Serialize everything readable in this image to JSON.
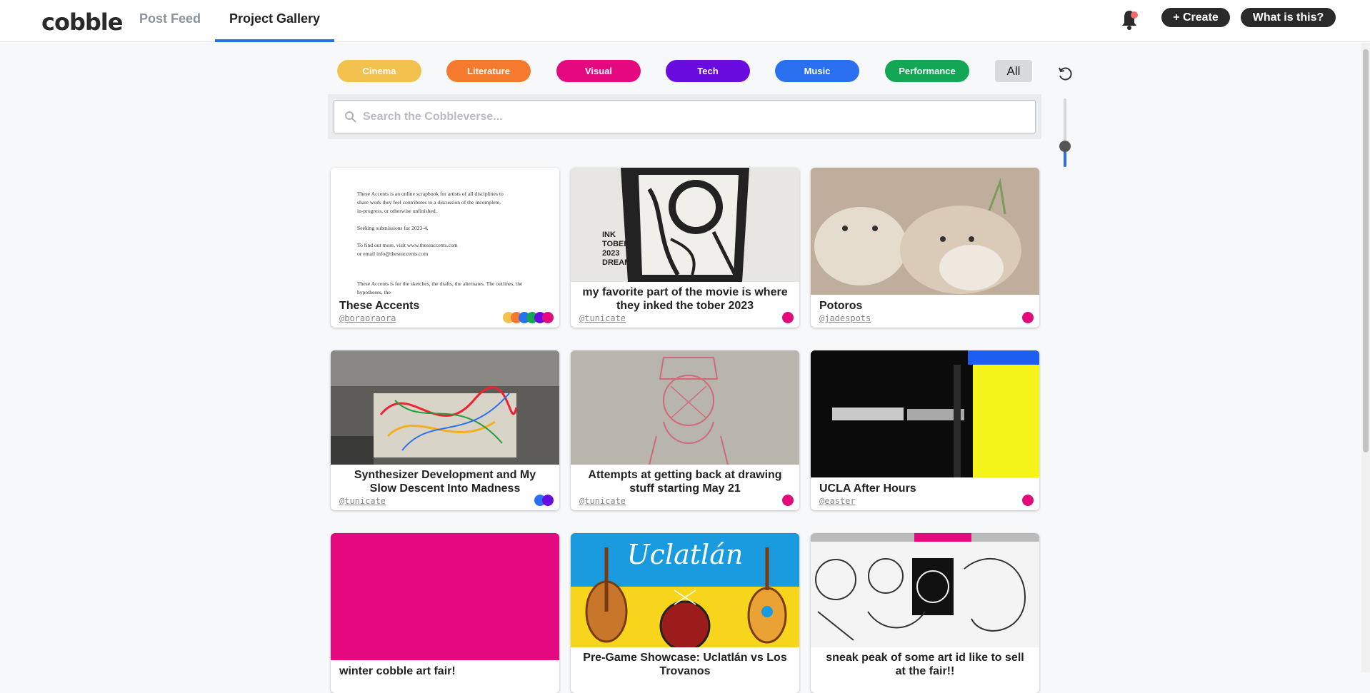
{
  "header": {
    "logo": "cobble",
    "tabs": [
      {
        "label": "Post Feed"
      },
      {
        "label": "Project Gallery"
      }
    ],
    "create_label": "+ Create",
    "about_label": "What is this?"
  },
  "categories": [
    {
      "label": "Cinema",
      "color": "#f2c14e"
    },
    {
      "label": "Literature",
      "color": "#f57a2e"
    },
    {
      "label": "Visual",
      "color": "#e5097f"
    },
    {
      "label": "Tech",
      "color": "#6a0be0"
    },
    {
      "label": "Music",
      "color": "#2a6ff0"
    },
    {
      "label": "Performance",
      "color": "#13a654"
    }
  ],
  "all_label": "All",
  "search": {
    "placeholder": "Search the Cobbleverse..."
  },
  "cards": [
    {
      "title": "These Accents",
      "user": "@boraoraora",
      "dots": [
        "#f2c14e",
        "#f57a2e",
        "#2a6ff0",
        "#13a654",
        "#6a0be0",
        "#e5097f"
      ],
      "doc_lines": [
        "These Accents is an online scrapbook for artists of all disciplines to",
        "share work they feel contributes to a discussion of the incomplete,",
        "in-progress, or otherwise unfinished.",
        "Seeking submissions for 2023-4.",
        "To find out more, visit www.theseaccents.com",
        "or email info@theseaccents.com",
        "These Accents is for the sketches, the drafts, the alternates. The outlines, the hypotheses, the"
      ]
    },
    {
      "title": "my favorite part of the movie is where they inked the tober 2023",
      "user": "@tunicate",
      "dots": [
        "#e5097f"
      ],
      "art_text": "INK TOBER 2023 DREAM"
    },
    {
      "title": "Potoros",
      "user": "@jadespots",
      "dots": [
        "#e5097f"
      ]
    },
    {
      "title": "Synthesizer Development and My Slow Descent Into Madness",
      "user": "@tunicate",
      "dots": [
        "#2a6ff0",
        "#6a0be0"
      ]
    },
    {
      "title": "Attempts at getting back at drawing stuff starting May 21",
      "user": "@tunicate",
      "dots": [
        "#e5097f"
      ]
    },
    {
      "title": "UCLA After Hours",
      "user": "@easter",
      "dots": [
        "#e5097f"
      ]
    },
    {
      "title": "winter cobble art fair!",
      "user": "",
      "dots": []
    },
    {
      "title": "Pre-Game Showcase: Uclatlán vs Los Trovanos",
      "user": "",
      "dots": [],
      "art_text": "Uclatlán"
    },
    {
      "title": "sneak peak of some art id like to sell at the fair!!",
      "user": "",
      "dots": []
    }
  ]
}
